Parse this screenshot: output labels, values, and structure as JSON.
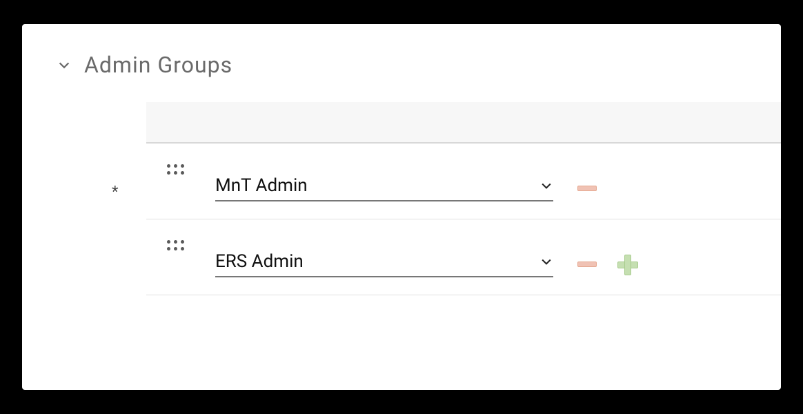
{
  "section": {
    "title": "Admin Groups",
    "required_mark": "*"
  },
  "rows": [
    {
      "value": "MnT Admin",
      "required": true,
      "has_add": false
    },
    {
      "value": "ERS Admin",
      "required": false,
      "has_add": true
    }
  ]
}
